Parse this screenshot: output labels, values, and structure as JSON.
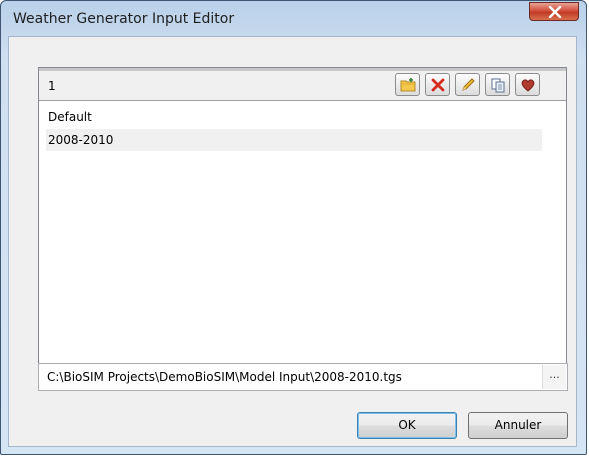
{
  "window": {
    "title": "Weather Generator Input Editor"
  },
  "list": {
    "header": "1",
    "items": [
      {
        "label": "Default",
        "selected": false
      },
      {
        "label": "2008-2010",
        "selected": true
      }
    ]
  },
  "toolbar": {
    "icons": [
      "folder-add-icon",
      "delete-x-icon",
      "edit-pencil-icon",
      "copy-icon",
      "favorite-heart-icon"
    ]
  },
  "path": {
    "value": "C:\\BioSIM Projects\\DemoBioSIM\\Model Input\\2008-2010.tgs",
    "browse_label": "..."
  },
  "buttons": {
    "ok_label": "OK",
    "cancel_label": "Annuler"
  },
  "colors": {
    "close_button": "#c13b26",
    "frame": "#c4d7ec",
    "default_button_border": "#3c7fb1"
  }
}
